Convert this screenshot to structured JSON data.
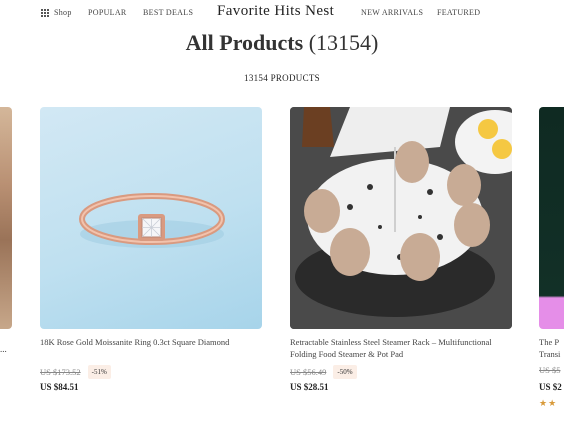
{
  "nav": {
    "shop": "Shop",
    "popular": "POPULAR",
    "best_deals": "BEST DEALS",
    "brand": "Favorite Hits Nest",
    "new_arrivals": "NEW ARRIVALS",
    "featured": "FEATURED"
  },
  "page": {
    "title": "All Products",
    "title_count": "(13154)",
    "products_count": "13154 PRODUCTS"
  },
  "products": [
    {
      "name_partial": "..."
    },
    {
      "name": "18K Rose Gold Moissanite Ring 0.3ct Square Diamond",
      "old_price": "US $173.52",
      "discount": "-51%",
      "price": "US $84.51"
    },
    {
      "name": "Retractable Stainless Steel Steamer Rack – Multifunctional Folding Food Steamer & Pot Pad",
      "old_price": "US $56.49",
      "discount": "-50%",
      "price": "US $28.51"
    },
    {
      "name": "The P",
      "name_line2": "Transi",
      "old_price": "US $5",
      "price": "US $2",
      "rating": 2
    }
  ],
  "colors": {
    "accent_badge": "#fbeee6",
    "star": "#d89a3a"
  }
}
